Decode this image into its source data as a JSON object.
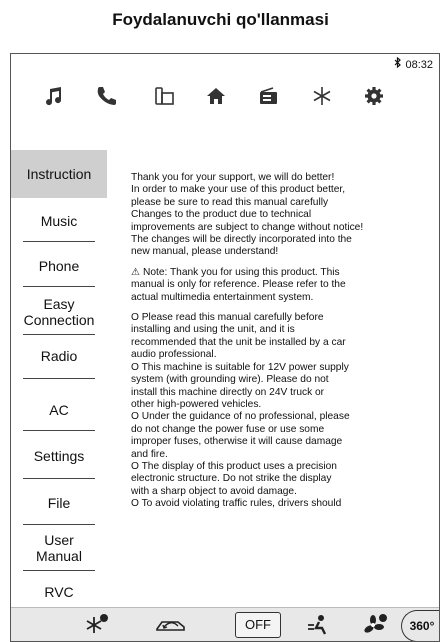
{
  "document": {
    "title": "Foydalanuvchi qo'llanmasi"
  },
  "status": {
    "bluetooth_icon": "bluetooth-icon",
    "time": "08:32"
  },
  "topbar": {
    "icons": [
      "music-icon",
      "phone-icon",
      "easy-connection-icon",
      "home-icon",
      "radio-icon",
      "ac-icon",
      "settings-icon"
    ]
  },
  "sidebar": {
    "items": [
      {
        "label": "Instruction",
        "active": true
      },
      {
        "label": "Music"
      },
      {
        "label": "Phone"
      },
      {
        "label": "Easy\nConnection"
      },
      {
        "label": "Radio"
      },
      {
        "label": "AC"
      },
      {
        "label": "Settings"
      },
      {
        "label": "File"
      },
      {
        "label": "User\nManual"
      },
      {
        "label": "RVC"
      }
    ]
  },
  "content": {
    "intro_lines": [
      "Thank you for your support, we will do better!",
      "In order to make your use of this product better,",
      "please be sure to read this manual carefully",
      "Changes to the product due to technical",
      "improvements are subject to change without notice!",
      "The changes will be directly incorporated into the",
      "new manual, please understand!"
    ],
    "note_lines": [
      "⚠ Note: Thank you for using this product. This",
      "manual is only for reference. Please refer to the",
      "actual multimedia entertainment system."
    ],
    "bullets": [
      [
        "O Please read this manual carefully before",
        "installing and using the unit, and it is",
        "recommended that the unit be installed by a car",
        "audio professional."
      ],
      [
        "O This machine is suitable for 12V power supply",
        "system (with grounding wire). Please do not",
        "install this machine directly on 24V truck or",
        "other high-powered vehicles."
      ],
      [
        "O Under the guidance of no professional, please",
        "do not change the power fuse or use some",
        "improper fuses, otherwise it will cause damage",
        "and fire."
      ],
      [
        "O The display of this product uses a precision",
        "electronic structure. Do not strike the display",
        "with a sharp object to avoid damage."
      ],
      [
        "O To avoid violating traffic rules, drivers should"
      ]
    ]
  },
  "bottombar": {
    "icons": [
      "rear-defrost-icon",
      "recirculation-icon",
      "fan-direction-icon",
      "fan-speed-icon"
    ],
    "off_label": "OFF",
    "view_label": "360°"
  }
}
